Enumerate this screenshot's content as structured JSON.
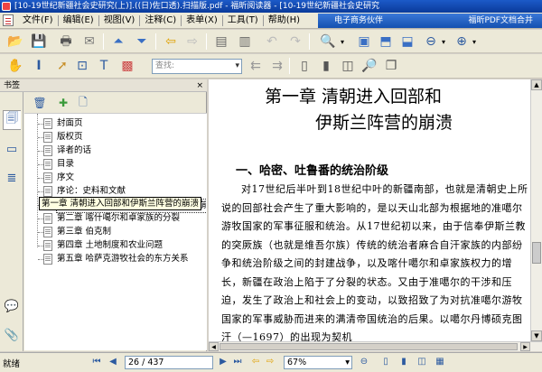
{
  "window": {
    "title": "[10-19世纪新疆社会史研究(上)].((日)佐口透).扫描版.pdf - 福昕阅读器 - [10-19世纪新疆社会史研究"
  },
  "menubar": {
    "items": [
      "文件(F)",
      "编辑(E)",
      "视图(V)",
      "注释(C)",
      "表单(X)",
      "工具(T)",
      "帮助(H)"
    ],
    "ad_left": "电子商务伙伴",
    "ad_right": "福昕PDF文档合并"
  },
  "toolbar": {
    "search_placeholder": "查找:"
  },
  "panel": {
    "header": "书签",
    "close": "×",
    "bookmarks": [
      {
        "label": "封面页"
      },
      {
        "label": "版权页"
      },
      {
        "label": "译者的话"
      },
      {
        "label": "目录"
      },
      {
        "label": "序文"
      },
      {
        "label": "序论：史料和文献"
      },
      {
        "label": "第一章  清朝进入回部和伊斯兰阵营的崩溃"
      },
      {
        "label": "第二章  喀什噶尔和卓家族的分裂"
      },
      {
        "label": "第三章  伯克制"
      },
      {
        "label": "第四章  土地制度和农业问题"
      },
      {
        "label": "第五章  哈萨克游牧社会的东方关系"
      }
    ],
    "tooltip": "第一章  清朝进入回部和伊斯兰阵营的崩溃"
  },
  "document": {
    "chapter_line1": "第一章   清朝进入回部和",
    "chapter_line2": "伊斯兰阵营的崩溃",
    "section_title": "一、哈密、吐鲁番的统治阶级",
    "paragraph": "对17世纪后半叶到18世纪中叶的新疆南部，也就是清朝史上所说的回部社会产生了重大影响的，是以天山北部为根据地的准噶尔游牧国家的军事征服和统治。从17世纪初以来，由于信奉伊斯兰教的突厥族（也就是维吾尔族）传统的统治者麻合自汗家族的内部纷争和统治阶级之间的封建战争，以及喀什噶尔和卓家族权力的增长，新疆在政治上陷于了分裂的状态。又由于准噶尔的干涉和压迫，发生了政治上和社会上的变动，以致招致了为对抗准噶尔游牧国家的军事威胁而进来的满清帝国统治的后果。以噶尔丹博硕克图汗（—1697）的出现为契机"
  },
  "statusbar": {
    "status": "就绪",
    "page_field": "26 / 437",
    "zoom_field": "67%"
  }
}
